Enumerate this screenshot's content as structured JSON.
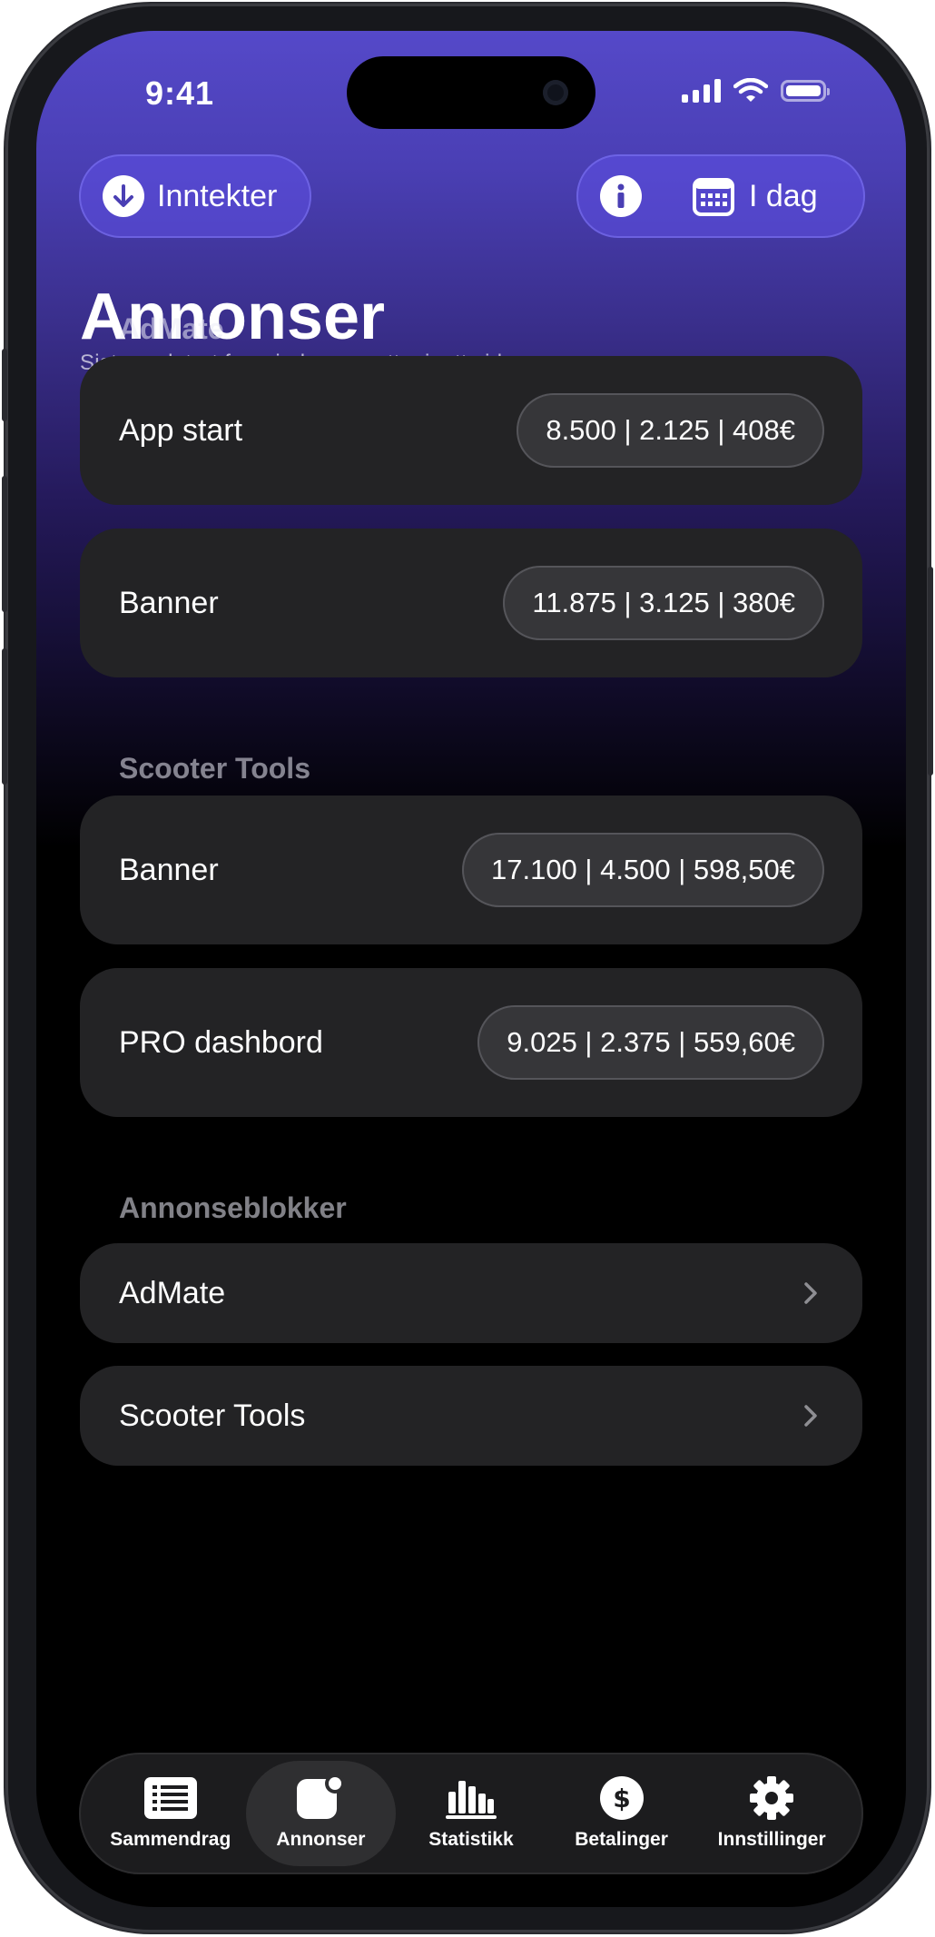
{
  "status_bar": {
    "time": "9:41"
  },
  "header": {
    "income_button_label": "Inntekter",
    "date_button_label": "I dag",
    "title": "Annonser",
    "subtitle": "Sist oppdatert for mindre enn ett minutt siden"
  },
  "sections": [
    {
      "header": "AdMate",
      "rows": [
        {
          "label": "App start",
          "value": "8.500 | 2.125 | 408€"
        },
        {
          "label": "Banner",
          "value": "11.875 | 3.125 | 380€"
        }
      ]
    },
    {
      "header": "Scooter Tools",
      "rows": [
        {
          "label": "Banner",
          "value": "17.100 | 4.500 | 598,50€"
        },
        {
          "label": "PRO dashbord",
          "value": "9.025 | 2.375 | 559,60€"
        }
      ]
    },
    {
      "header": "Annonseblokker",
      "rows": [
        {
          "label": "AdMate"
        },
        {
          "label": "Scooter Tools"
        }
      ]
    }
  ],
  "tab_bar": {
    "items": [
      {
        "label": "Sammendrag",
        "icon": "list-icon",
        "active": false
      },
      {
        "label": "Annonser",
        "icon": "app-badge-icon",
        "active": true
      },
      {
        "label": "Statistikk",
        "icon": "chart-bars-icon",
        "active": false
      },
      {
        "label": "Betalinger",
        "icon": "dollar-circle-icon",
        "active": false
      },
      {
        "label": "Innstillinger",
        "icon": "gear-icon",
        "active": false
      }
    ]
  },
  "colors": {
    "accent_top": "#5549c9",
    "card_background": "#232325",
    "value_pill_background": "#363639"
  }
}
